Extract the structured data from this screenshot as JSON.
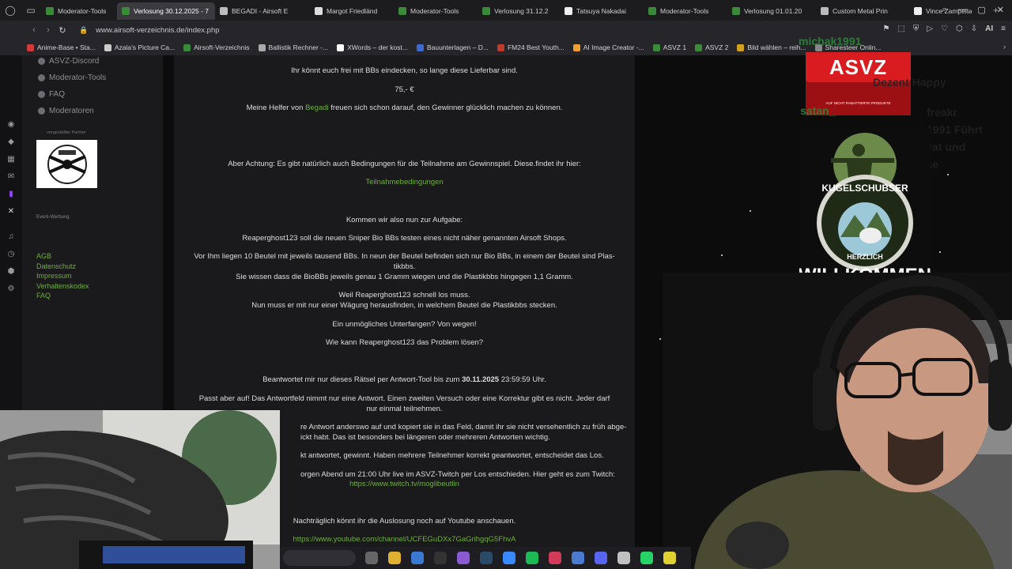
{
  "browser": {
    "tabs": [
      {
        "label": "Moderator-Tools",
        "color": "#3a8a3a",
        "active": false
      },
      {
        "label": "Verlosung 30.12.2025 - 7",
        "color": "#3a8a3a",
        "active": true
      },
      {
        "label": "BEGADI - Airsoft E",
        "color": "#bbbbbb",
        "active": false
      },
      {
        "label": "Margot Friedländ",
        "color": "#dddddd",
        "active": false
      },
      {
        "label": "Moderator-Tools",
        "color": "#3a8a3a",
        "active": false
      },
      {
        "label": "Verlosung 31.12.2",
        "color": "#3a8a3a",
        "active": false
      },
      {
        "label": "Tatsuya Nakadai",
        "color": "#eeeeee",
        "active": false
      },
      {
        "label": "Moderator-Tools",
        "color": "#3a8a3a",
        "active": false
      },
      {
        "label": "Verlosung 01.01.20",
        "color": "#3a8a3a",
        "active": false
      },
      {
        "label": "Custom Metal Prin",
        "color": "#bbbbbb",
        "active": false
      },
      {
        "label": "Vince Zampella",
        "color": "#eeeeee",
        "active": false
      }
    ],
    "url": "www.airsoft-verzeichnis.de/index.php",
    "ai_label": "AI",
    "bookmarks": [
      {
        "label": "Anime-Base • Sta...",
        "color": "#d23a3a"
      },
      {
        "label": "Azala's Picture Ca...",
        "color": "#cccccc"
      },
      {
        "label": "Airsoft-Verzeichnis",
        "color": "#3a8a3a"
      },
      {
        "label": "Ballistik Rechner -...",
        "color": "#aaaaaa"
      },
      {
        "label": "XWords – der kost...",
        "color": "#ffffff"
      },
      {
        "label": "Bauunterlagen – D...",
        "color": "#3a6ad2"
      },
      {
        "label": "FM24 Best Youth...",
        "color": "#c0392b"
      },
      {
        "label": "AI Image Creator -...",
        "color": "#f0a030"
      },
      {
        "label": "ASVZ 1",
        "color": "#3a8a3a"
      },
      {
        "label": "ASVZ 2",
        "color": "#3a8a3a"
      },
      {
        "label": "Bild wählen – reih...",
        "color": "#d4a020"
      },
      {
        "label": "Sharesteer Onlin...",
        "color": "#888888"
      }
    ]
  },
  "site": {
    "nav": [
      {
        "label": "ASVZ-Discord"
      },
      {
        "label": "Moderator-Tools"
      },
      {
        "label": "FAQ"
      },
      {
        "label": "Moderatoren"
      }
    ],
    "partner_label": "vorgestellter Partner",
    "event_label": "Event-Werbung",
    "footer_links": [
      "AGB",
      "Datenschutz",
      "Impressum",
      "Verhaltenskodex",
      "FAQ"
    ]
  },
  "article": {
    "p1": "Ihr könnt euch frei mit BBs eindecken, so lange diese Lieferbar sind.",
    "price": "75,- €",
    "helpers_pre": "Meine Helfer von ",
    "helpers_link": "Begadi",
    "helpers_post": " freuen sich schon darauf, den Gewinner glücklich machen zu können.",
    "conditions": "Aber Achtung: Es gibt natürlich auch Bedingungen für die Teilnahme am Gewinnspiel. Diese.findet ihr hier:",
    "conditions_link": "Teilnahmebedingungen",
    "task_intro": "Kommen wir also nun zur Aufgabe:",
    "task_1": "Reaperghost123 soll die neuen Sniper Bio BBs testen eines nicht näher genannten Airsoft Shops.",
    "task_2a": "Vor Ihm liegen 10 Beutel mit jeweils tausend BBs. In neun der Beutel befinden sich nur Bio BBs, in einem der Beutel sind Plas-",
    "task_2b": "tikbbs.",
    "task_3": "Sie wissen dass die BioBBs jeweils genau 1 Gramm wiegen und die Plastikbbs hingegen 1,1 Gramm.",
    "task_4a": "Weil Reaperghost123 schnell los muss.",
    "task_4b": "Nun muss er mit nur einer Wägung herausfinden, in welchem Beutel die Plastikbbs stecken.",
    "task_5": "Ein unmögliches Unterfangen? Von wegen!",
    "task_6": "Wie kann Reaperghost123 das Problem lösen?",
    "answer_pre": "Beantwortet mir nur dieses Rätsel per Antwort-Tool bis zum ",
    "answer_date": "30.11.2025",
    "answer_post": " 23:59:59 Uhr.",
    "note_1a": "Passt aber auf! Das Antwortfeld nimmt nur eine Antwort. Einen zweiten Versuch oder eine Korrektur gibt es nicht. Jeder darf",
    "note_1b": "nur einmal teilnehmen.",
    "note_2a": "re Antwort anderswo auf und kopiert sie in das Feld, damit ihr sie nicht versehentlich  zu früh abge-",
    "note_2b": "ickt habt. Das ist besonders bei längeren oder mehreren Antworten wichtig.",
    "note_3": "kt antwortet, gewinnt. Haben mehrere Teilnehmer korrekt geantwortet, entscheidet das Los.",
    "note_4": "orgen Abend um 21:00 Uhr live im ASVZ-Twitch per Los entschieden. Hier geht es zum Twitch:",
    "twitch_link": "https://www.twitch.tv/moglibeutlin",
    "youtube_text": "Nachträglich könnt ihr die Auslosung noch auf Youtube anschauen.",
    "youtube_link": "https://www.youtube.com/channel/UCFEGuDXx7GaGrihgqG5FhvA"
  },
  "overlays": {
    "banner_title": "ASVZ",
    "banner_sub": "AUF NICHT RABATTIERTE PRODUKTE",
    "chat": [
      {
        "text": "michak1991",
        "user": true
      },
      {
        "text": "Dezent Happy",
        "user": false
      },
      {
        "text": "satan_",
        "user": true
      },
      {
        "text": "freakr",
        "user": false
      },
      {
        "text": "1991 Führt",
        "user": false
      },
      {
        "text": "sowas Privat und",
        "user": false
      },
      {
        "text": "nich , danke",
        "user": false
      }
    ],
    "welcome_top": "KUGELSCHUBSER",
    "welcome_mid": "HERZLICH",
    "welcome_bottom": "WILLKOMMEN"
  },
  "taskbar": {
    "apps": [
      {
        "name": "files-icon",
        "color": "#666666"
      },
      {
        "name": "folder-icon",
        "color": "#e0b030"
      },
      {
        "name": "store-icon",
        "color": "#3a7ad2"
      },
      {
        "name": "epic-icon",
        "color": "#333333"
      },
      {
        "name": "app-icon",
        "color": "#8a5ad2"
      },
      {
        "name": "steam-icon",
        "color": "#2a4a6a"
      },
      {
        "name": "messenger-icon",
        "color": "#3a8aff"
      },
      {
        "name": "spotify-icon",
        "color": "#1db954"
      },
      {
        "name": "opera-gx-icon",
        "color": "#d23a5a"
      },
      {
        "name": "blue-app-icon",
        "color": "#4a7ad2"
      },
      {
        "name": "discord-icon",
        "color": "#5865f2"
      },
      {
        "name": "sword-icon",
        "color": "#c0c0c0"
      },
      {
        "name": "whatsapp-icon",
        "color": "#25d366"
      },
      {
        "name": "lemon-icon",
        "color": "#e0d030"
      }
    ]
  }
}
